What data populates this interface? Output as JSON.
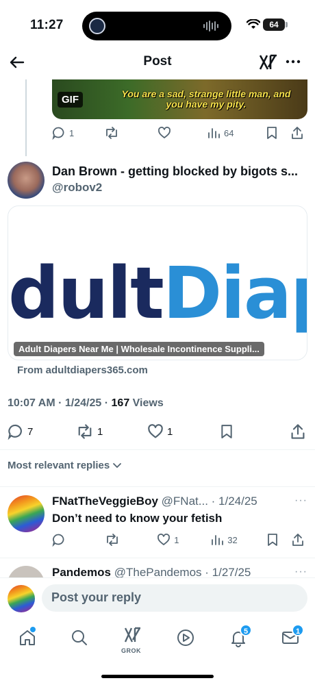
{
  "status_bar": {
    "time": "11:27",
    "battery": "64"
  },
  "header": {
    "title": "Post"
  },
  "gif": {
    "badge": "GIF",
    "caption": "You are a sad, strange little man, and you have my pity."
  },
  "parent_actions": {
    "replies": "1",
    "reposts": "",
    "likes": "",
    "views": "64"
  },
  "post": {
    "display_name": "Dan Brown - getting blocked by bigots s...",
    "handle": "@robov2",
    "link_card": {
      "logo_dark": "dult",
      "logo_blue": "Diap",
      "title": "Adult Diapers Near Me | Wholesale Incontinence Suppli...",
      "domain": "From adultdiapers365.com"
    },
    "time": "10:07 AM",
    "date": "1/24/25",
    "views_count": "167",
    "views_label": "Views",
    "actions": {
      "replies": "7",
      "reposts": "1",
      "likes": "1"
    }
  },
  "replies_sort": {
    "label": "Most relevant replies"
  },
  "reply": {
    "display_name": "FNatTheVeggieBoy",
    "handle_date": "@FNat... · 1/24/25",
    "more": "···",
    "text": "Don’t need to know your fetish",
    "actions": {
      "replies": "",
      "reposts": "",
      "likes": "1",
      "views": "32"
    }
  },
  "reply2": {
    "display_name": "Pandemos",
    "handle_date": "@ThePandemos · 1/27/25",
    "more": "···"
  },
  "compose": {
    "placeholder": "Post your reply"
  },
  "tab_bar": {
    "grok_label": "GROK",
    "notifications_badge": "5",
    "messages_badge": "1"
  }
}
